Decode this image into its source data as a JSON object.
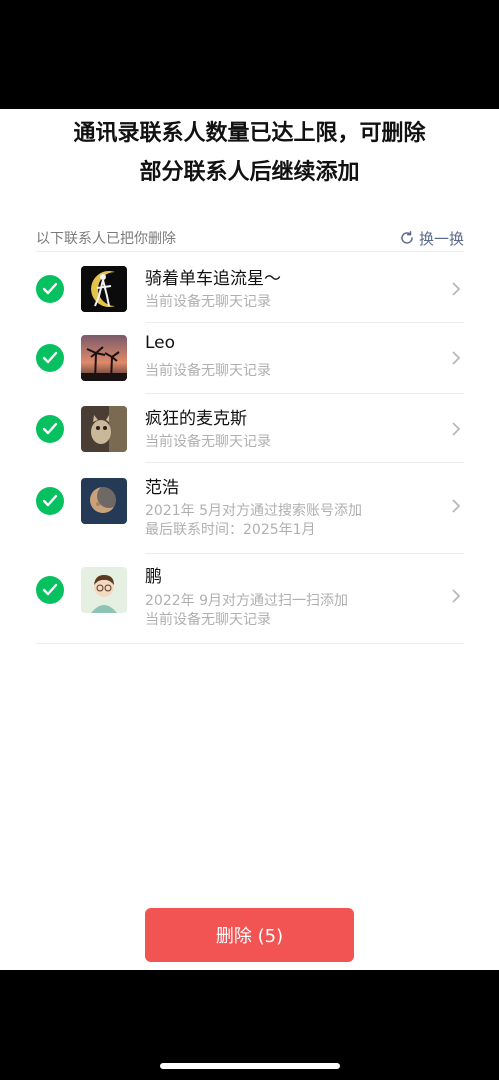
{
  "header": {
    "title_line1": "通讯录联系人数量已达上限，可删除",
    "title_line2": "部分联系人后继续添加"
  },
  "section": {
    "label": "以下联系人已把你删除",
    "refresh_label": "换一换"
  },
  "contacts": [
    {
      "name": "骑着单车追流星～",
      "line1": "当前设备无聊天记录",
      "line2": "",
      "avatar": "sailor-moon-avatar"
    },
    {
      "name": "Leo",
      "line1": "当前设备无聊天记录",
      "line2": "",
      "avatar": "palm-sunset-avatar"
    },
    {
      "name": "疯狂的麦克斯",
      "line1": "当前设备无聊天记录",
      "line2": "",
      "avatar": "cat-photo-avatar"
    },
    {
      "name": "范浩",
      "line1": "2021年 5月对方通过搜索账号添加",
      "line2": "最后联系时间：2025年1月",
      "avatar": "moon-avatar"
    },
    {
      "name": "鹏",
      "line1": "2022年 9月对方通过扫一扫添加",
      "line2": "当前设备无聊天记录",
      "avatar": "cartoon-boy-avatar"
    }
  ],
  "footer": {
    "delete_label": "删除 (5)"
  },
  "colors": {
    "check": "#07c160",
    "delete_button": "#f25353",
    "link": "#5a6b8c"
  }
}
